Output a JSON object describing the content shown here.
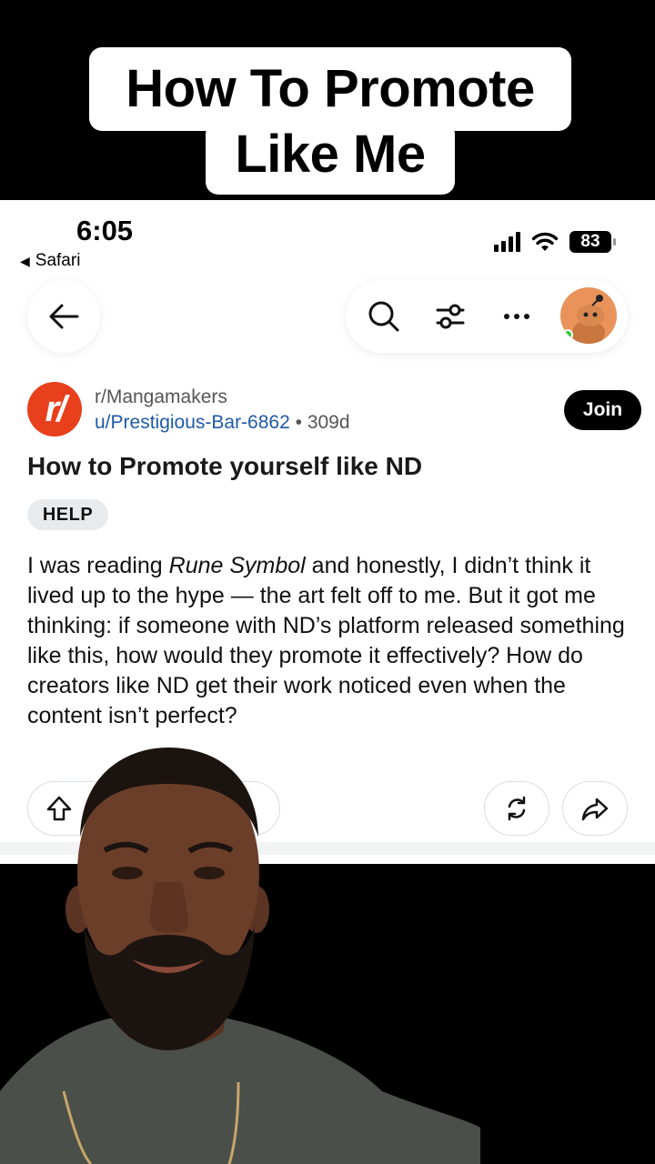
{
  "caption": {
    "line1": "How To Promote",
    "line2": "Like Me"
  },
  "status_bar": {
    "time": "6:05",
    "back_app": "Safari",
    "battery": "83"
  },
  "nav": {
    "back_icon": "arrow-left-icon",
    "search_icon": "search-icon",
    "filter_icon": "sliders-icon",
    "more_icon": "ellipsis-icon",
    "avatar_icon": "user-avatar"
  },
  "post": {
    "subreddit": "r/Mangamakers",
    "author": "u/Prestigious-Bar-6862",
    "separator": "•",
    "age": "309d",
    "join_label": "Join",
    "title": "How to Promote yourself like ND",
    "flair": "HELP",
    "body_pre": "I was reading ",
    "body_em": "Rune Symbol",
    "body_post": " and honestly, I didn’t think it lived up to the hype — the art felt off to me. But it got me thinking: if someone with ND’s platform released something like this, how would they promote it effectively? How do creators like ND get their work noticed even when the content isn’t perfect?"
  },
  "colors": {
    "subreddit_icon": "#e8401c",
    "user_link": "#1e5aa8",
    "join_bg": "#000000",
    "flair_bg": "#e8ebee",
    "avatar_bg": "#e9935a",
    "online_dot": "#2ecc40"
  }
}
